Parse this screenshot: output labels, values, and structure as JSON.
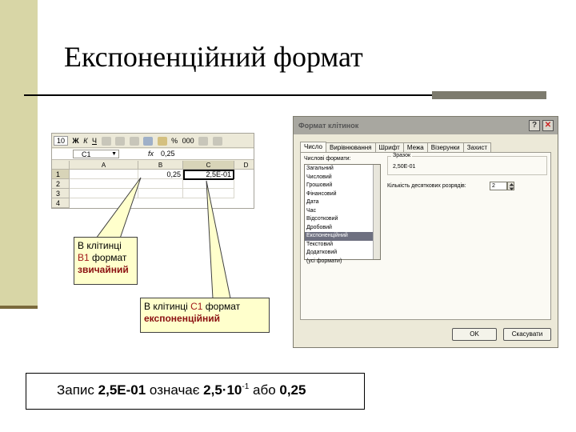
{
  "slide": {
    "title": "Експоненційний формат"
  },
  "spreadsheet": {
    "toolbar": {
      "zoom": "10",
      "bold": "Ж",
      "italic": "К",
      "underline": "Ч",
      "percent": "%",
      "thousands": "000"
    },
    "name_box": "C1",
    "fx": "fx",
    "formula": "0,25",
    "columns": [
      "A",
      "B",
      "C",
      "D"
    ],
    "rows": [
      "1",
      "2",
      "3",
      "4"
    ],
    "b1": "0,25",
    "c1": "2,5E-01"
  },
  "callouts": {
    "b1": {
      "line1": "В клітинці",
      "cell": "B1",
      "mid": " формат",
      "format": "звичайний"
    },
    "c1": {
      "prefix": "В клітинці ",
      "cell": "C1",
      "mid": " формат",
      "format": "експоненційний"
    }
  },
  "dialog": {
    "title": "Формат клітинок",
    "help": "?",
    "close": "✕",
    "tabs": [
      "Число",
      "Вирівнювання",
      "Шрифт",
      "Межа",
      "Візерунки",
      "Захист"
    ],
    "formats_label": "Числові формати:",
    "formats": [
      "Загальний",
      "Числовий",
      "Грошовий",
      "Фінансовий",
      "Дата",
      "Час",
      "Відсотковий",
      "Дробовий",
      "Експоненційний",
      "Текстовий",
      "Додатковий",
      "(усі формати)"
    ],
    "selected_index": 8,
    "sample_label": "Зразок",
    "sample_value": "2,50E-01",
    "decimals_label": "Кількість десяткових розрядів:",
    "decimals_value": "2",
    "ok": "OK",
    "cancel": "Скасувати"
  },
  "note": {
    "prefix": "Запис ",
    "code": "2,5E-01",
    "mid": " означає ",
    "mantissa": "2,5·10",
    "exponent": "-1",
    "or": " або ",
    "value": "0,25"
  },
  "colors": {
    "sidebar": "#d8d6a6",
    "callout_bg": "#ffffcc",
    "selected_format": "#6e7080",
    "accent_red": "#a21a1a"
  }
}
